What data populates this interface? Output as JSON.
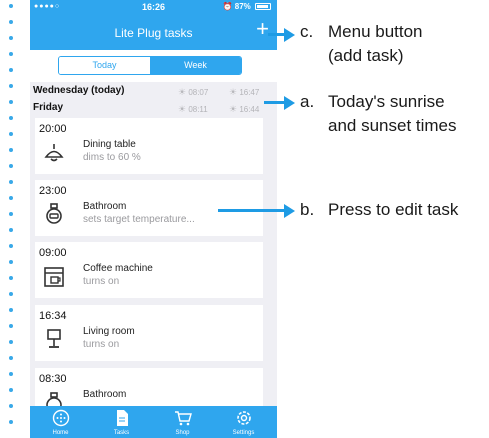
{
  "status_bar": {
    "signal": "●●●●○",
    "time": "16:26",
    "battery": "87%"
  },
  "nav": {
    "title": "Lite Plug tasks",
    "add_icon": "plus-icon"
  },
  "segment": {
    "today": "Today",
    "week": "Week"
  },
  "sun_rows": [
    {
      "day": "Wednesday (today)",
      "sunrise": "08:07",
      "sunset": "16:47"
    },
    {
      "day": "Friday",
      "sunrise": "08:11",
      "sunset": "16:44"
    }
  ],
  "tasks": [
    {
      "time": "20:00",
      "name": "Dining table",
      "desc": "dims to 60 %",
      "icon": "ceiling-lamp-icon"
    },
    {
      "time": "23:00",
      "name": "Bathroom",
      "desc": "sets target temperature...",
      "icon": "heater-icon"
    },
    {
      "time": "09:00",
      "name": "Coffee machine",
      "desc": "turns on",
      "icon": "coffee-machine-icon"
    },
    {
      "time": "16:34",
      "name": "Living room",
      "desc": "turns on",
      "icon": "table-lamp-icon"
    },
    {
      "time": "08:30",
      "name": "Bathroom",
      "desc": "",
      "icon": "heater-icon"
    }
  ],
  "tab_bar": [
    {
      "label": "Home",
      "icon": "home-icon"
    },
    {
      "label": "Tasks",
      "icon": "tasks-icon"
    },
    {
      "label": "Shop",
      "icon": "cart-icon"
    },
    {
      "label": "Settings",
      "icon": "settings-icon"
    }
  ],
  "annotations": {
    "c": {
      "letter": "c.",
      "line1": "Menu button",
      "line2": "(add task)"
    },
    "a": {
      "letter": "a.",
      "line1": "Today's sunrise",
      "line2": "and sunset times"
    },
    "b": {
      "letter": "b.",
      "line1": "Press to edit task"
    }
  },
  "colors": {
    "accent": "#2fa6ee",
    "annotation": "#1e9be4",
    "background": "#efeff4"
  }
}
